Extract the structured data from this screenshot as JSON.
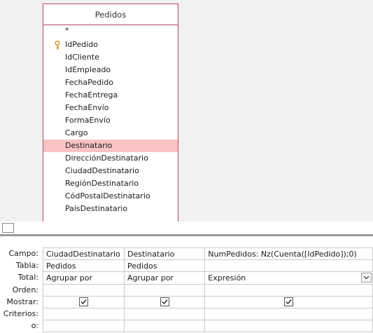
{
  "table_panel": {
    "title": "Pedidos",
    "fields": [
      {
        "label": "*",
        "key": false,
        "selected": false
      },
      {
        "label": "IdPedido",
        "key": true,
        "selected": false
      },
      {
        "label": "IdCliente",
        "key": false,
        "selected": false
      },
      {
        "label": "IdEmpleado",
        "key": false,
        "selected": false
      },
      {
        "label": "FechaPedido",
        "key": false,
        "selected": false
      },
      {
        "label": "FechaEntrega",
        "key": false,
        "selected": false
      },
      {
        "label": "FechaEnvío",
        "key": false,
        "selected": false
      },
      {
        "label": "FormaEnvío",
        "key": false,
        "selected": false
      },
      {
        "label": "Cargo",
        "key": false,
        "selected": false
      },
      {
        "label": "Destinatario",
        "key": false,
        "selected": true
      },
      {
        "label": "DirecciónDestinatario",
        "key": false,
        "selected": false
      },
      {
        "label": "CiudadDestinatario",
        "key": false,
        "selected": false
      },
      {
        "label": "RegiónDestinatario",
        "key": false,
        "selected": false
      },
      {
        "label": "CódPostalDestinatario",
        "key": false,
        "selected": false
      },
      {
        "label": "PaísDestinatario",
        "key": false,
        "selected": false
      }
    ]
  },
  "grid": {
    "row_labels": [
      "Campo:",
      "Tabla:",
      "Total:",
      "Orden:",
      "Mostrar:",
      "Criterios:",
      "o:"
    ],
    "columns": [
      {
        "campo": "CiudadDestinatario",
        "tabla": "Pedidos",
        "total": "Agrupar por",
        "orden": "",
        "mostrar": true,
        "criterios": "",
        "o": ""
      },
      {
        "campo": "Destinatario",
        "tabla": "Pedidos",
        "total": "Agrupar por",
        "orden": "",
        "mostrar": true,
        "criterios": "",
        "o": ""
      },
      {
        "campo": "NumPedidos: Nz(Cuenta([IdPedido]);0)",
        "tabla": "",
        "total": "Expresión",
        "orden": "",
        "mostrar": true,
        "criterios": "",
        "o": ""
      }
    ]
  },
  "colors": {
    "table_border": "#b5486a",
    "selected_row": "#f9c3c4",
    "key_icon": "#c9a227",
    "background": "#f1f1f1"
  },
  "icons": {
    "primary_key": "key-icon",
    "check": "check-icon",
    "dropdown": "chevron-down-icon"
  }
}
